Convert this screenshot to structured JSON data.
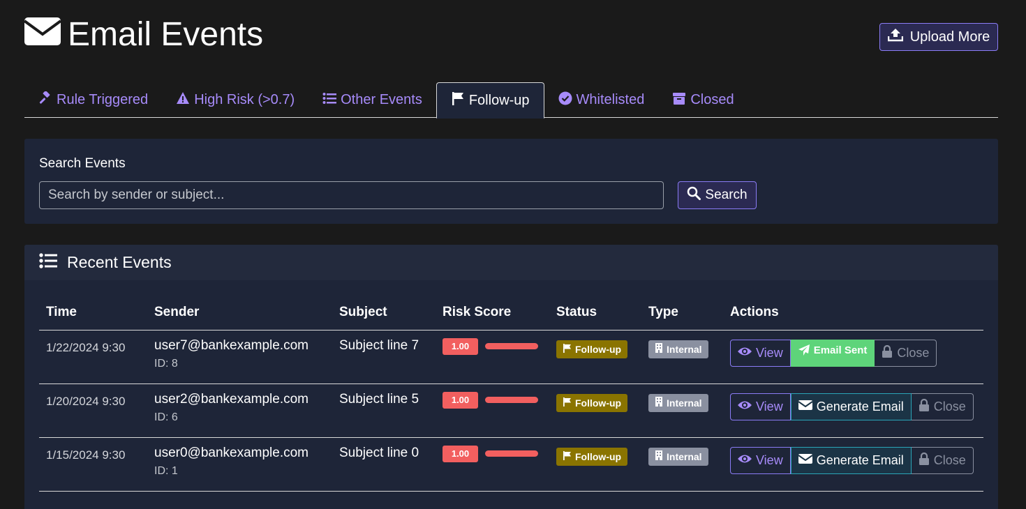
{
  "header": {
    "title": "Email Events",
    "upload_label": "Upload More"
  },
  "tabs": [
    {
      "label": "Rule Triggered",
      "icon": "gavel-icon",
      "active": false
    },
    {
      "label": "High Risk (>0.7)",
      "icon": "warning-icon",
      "active": false
    },
    {
      "label": "Other Events",
      "icon": "list-icon",
      "active": false
    },
    {
      "label": "Follow-up",
      "icon": "flag-icon",
      "active": true
    },
    {
      "label": "Whitelisted",
      "icon": "check-circle-icon",
      "active": false
    },
    {
      "label": "Closed",
      "icon": "archive-icon",
      "active": false
    }
  ],
  "search": {
    "label": "Search Events",
    "placeholder": "Search by sender or subject...",
    "value": "",
    "button_label": "Search"
  },
  "events": {
    "title": "Recent Events",
    "columns": [
      "Time",
      "Sender",
      "Subject",
      "Risk Score",
      "Status",
      "Type",
      "Actions"
    ],
    "rows": [
      {
        "time": "1/22/2024 9:30",
        "sender": "user7@bankexample.com",
        "id": "ID: 8",
        "subject": "Subject line 7",
        "risk": "1.00",
        "risk_fraction": 1.0,
        "status": "Follow-up",
        "type": "Internal",
        "view": "View",
        "email_action": "Email Sent",
        "close": "Close"
      },
      {
        "time": "1/20/2024 9:30",
        "sender": "user2@bankexample.com",
        "id": "ID: 6",
        "subject": "Subject line 5",
        "risk": "1.00",
        "risk_fraction": 1.0,
        "status": "Follow-up",
        "type": "Internal",
        "view": "View",
        "email_action": "Generate Email",
        "close": "Close"
      },
      {
        "time": "1/15/2024 9:30",
        "sender": "user0@bankexample.com",
        "id": "ID: 1",
        "subject": "Subject line 0",
        "risk": "1.00",
        "risk_fraction": 1.0,
        "status": "Follow-up",
        "type": "Internal",
        "view": "View",
        "email_action": "Generate Email",
        "close": "Close"
      }
    ]
  },
  "colors": {
    "background": "#1a1a1a",
    "card": "#1e2538",
    "accent": "#a78bfa",
    "risk": "#f25f5f",
    "status_followup": "#8a7400",
    "type_internal": "#8a90a0",
    "email_sent": "#5ed47a"
  }
}
